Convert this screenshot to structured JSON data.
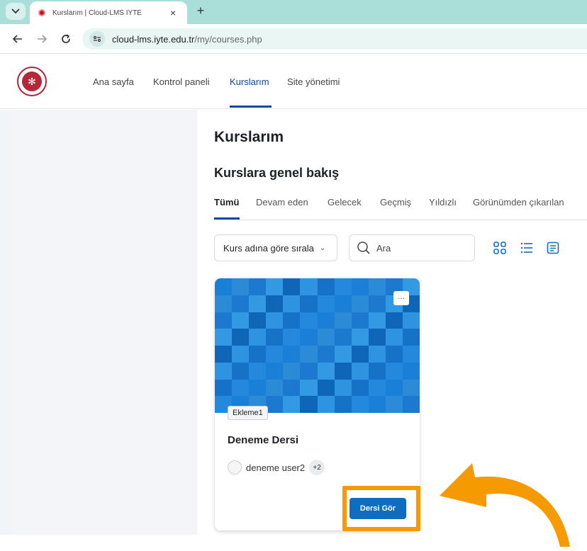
{
  "browser": {
    "tab_title": "Kurslarım | Cloud-LMS İYTE",
    "tab_close": "×",
    "new_tab": "+",
    "url_host": "cloud-lms.iyte.edu.tr",
    "url_path": "/my/courses.php"
  },
  "nav": {
    "items": [
      "Ana sayfa",
      "Kontrol paneli",
      "Kurslarım",
      "Site yönetimi"
    ],
    "active": "Kurslarım"
  },
  "page": {
    "title": "Kurslarım",
    "section_title": "Kurslara genel bakış"
  },
  "filters": {
    "tabs": [
      "Tümü",
      "Devam eden",
      "Gelecek",
      "Geçmiş",
      "Yıldızlı",
      "Görünümden çıkarılan"
    ],
    "active": "Tümü"
  },
  "controls": {
    "sort_label": "Kurs adına göre sırala",
    "search_placeholder": "Ara"
  },
  "course": {
    "category": "Ekleme1",
    "name": "Deneme Dersi",
    "teacher": "deneme user2",
    "teacher_more": "+2",
    "menu": "···",
    "button": "Dersi Gör"
  },
  "colors": {
    "accent": "#0f47ad",
    "button": "#0f6cbf",
    "highlight": "#f59a00",
    "course_image_blues": [
      "#1a7fd6",
      "#2488dc",
      "#1572c7",
      "#2e93e0",
      "#0f66b8",
      "#3499e3",
      "#1d78cf",
      "#2b8bd6"
    ]
  }
}
